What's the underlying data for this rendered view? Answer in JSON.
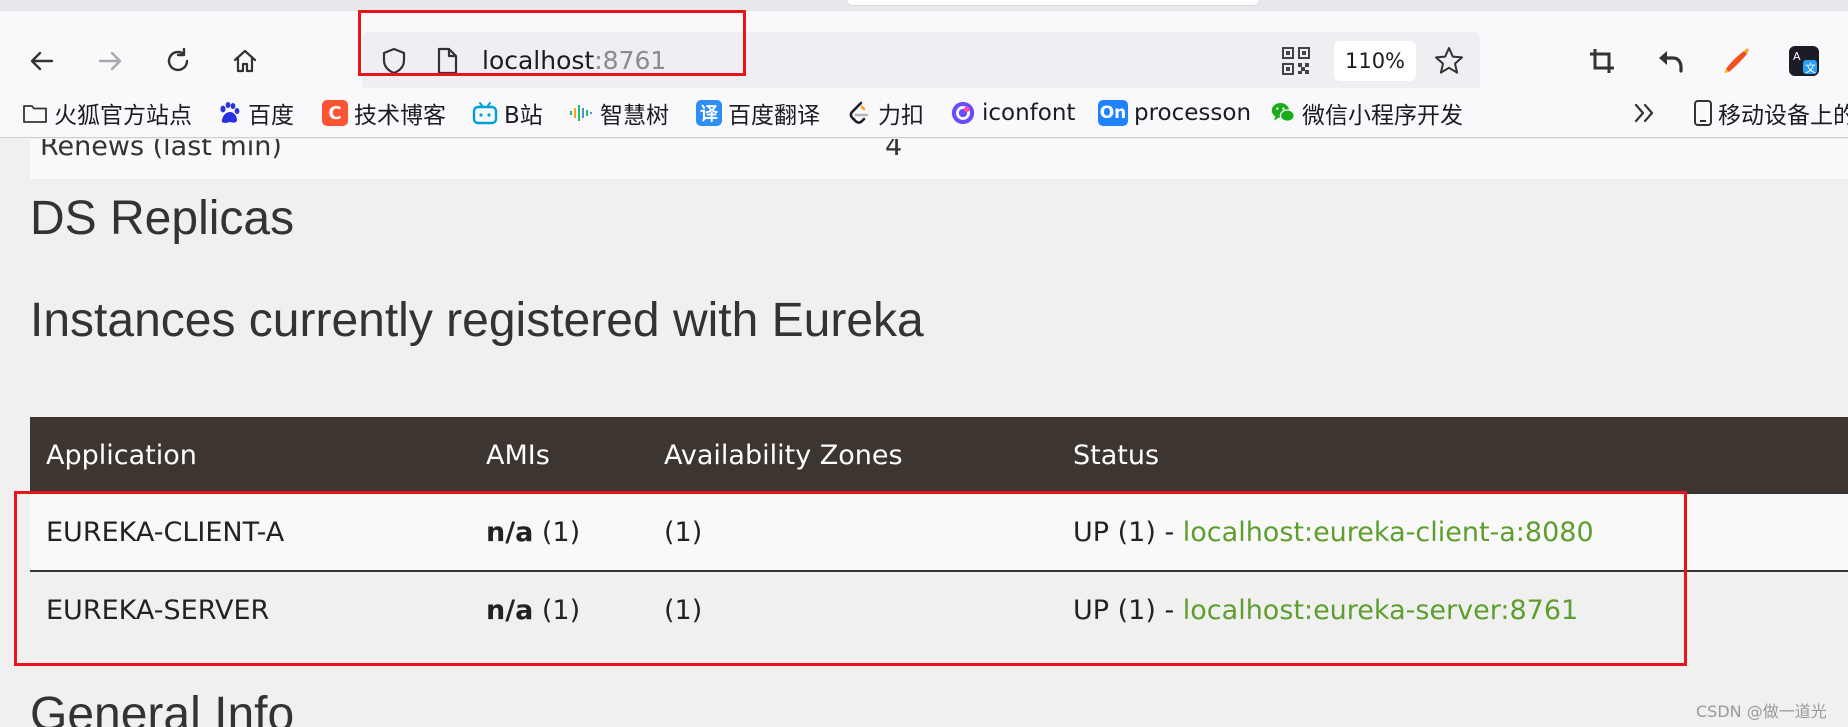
{
  "browser": {
    "url_host": "localhost",
    "url_port": ":8761",
    "zoom": "110%",
    "bookmarks": [
      {
        "label": "火狐官方站点",
        "icon": "folder-icon"
      },
      {
        "label": "百度",
        "icon": "baidu-paw-icon",
        "color": "#2932e1"
      },
      {
        "label": "技术博客",
        "icon": "csdn-c-icon",
        "glyph": "C",
        "color": "#fc5531"
      },
      {
        "label": "B站",
        "icon": "bilibili-tv-icon",
        "color": "#00a1d6"
      },
      {
        "label": "智慧树",
        "icon": "zhihuishu-waves-icon",
        "color": "#2bb673"
      },
      {
        "label": "百度翻译",
        "icon": "translate-icon",
        "glyph": "译",
        "color": "#2f8ef4"
      },
      {
        "label": "力扣",
        "icon": "leetcode-icon",
        "color": "#ffa116"
      },
      {
        "label": "iconfont",
        "icon": "iconfont-icon",
        "color": "#6a4cff"
      },
      {
        "label": "processon",
        "icon": "processon-icon",
        "glyph": "On",
        "color": "#1f82ff"
      },
      {
        "label": "微信小程序开发",
        "icon": "wechat-icon",
        "color": "#1aad19"
      }
    ],
    "overflow_label": "移动设备上的"
  },
  "page": {
    "renews_label": "Renews (last min)",
    "renews_value": "4",
    "ds_replicas_title": "DS Replicas",
    "instances_title": "Instances currently registered with Eureka",
    "table": {
      "headers": [
        "Application",
        "AMIs",
        "Availability Zones",
        "Status"
      ],
      "rows": [
        {
          "application": "EUREKA-CLIENT-A",
          "amis_bold": "n/a",
          "amis_count": " (1)",
          "zones": "(1)",
          "status": "UP (1) - ",
          "link": "localhost:eureka-client-a:8080"
        },
        {
          "application": "EUREKA-SERVER",
          "amis_bold": "n/a",
          "amis_count": " (1)",
          "zones": "(1)",
          "status": "UP (1) - ",
          "link": "localhost:eureka-server:8761"
        }
      ]
    },
    "general_info_title": "General Info"
  },
  "watermark": "CSDN @做一道光",
  "colors": {
    "highlight": "#e8141b",
    "table_header": "#3d3630",
    "link": "#5d9e2d"
  }
}
